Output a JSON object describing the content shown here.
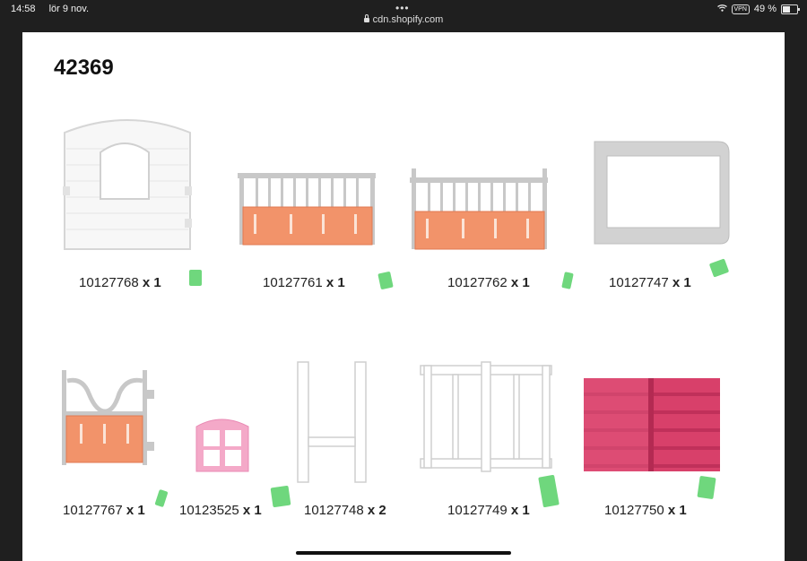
{
  "status": {
    "time": "14:58",
    "date": "lör 9 nov.",
    "vpn": "VPN",
    "battery": "49 %",
    "battery_level": 0.49
  },
  "browser": {
    "url": "cdn.shopify.com",
    "dots": "•••"
  },
  "doc": {
    "title": "42369",
    "parts": [
      {
        "number": "10127768",
        "qty": "x 1",
        "icon": "stable-wall-with-window"
      },
      {
        "number": "10127761",
        "qty": "x 1",
        "icon": "stall-gate-panel"
      },
      {
        "number": "10127762",
        "qty": "x 1",
        "icon": "stall-gate-panel"
      },
      {
        "number": "10127747",
        "qty": "x 1",
        "icon": "grey-frame"
      },
      {
        "number": "10127767",
        "qty": "x 1",
        "icon": "stall-door-with-arch"
      },
      {
        "number": "10123525",
        "qty": "x 1",
        "icon": "pink-window"
      },
      {
        "number": "10127748",
        "qty": "x 2",
        "icon": "h-post"
      },
      {
        "number": "10127749",
        "qty": "x 1",
        "icon": "white-fence-frame"
      },
      {
        "number": "10127750",
        "qty": "x 1",
        "icon": "pink-roof-panel"
      }
    ]
  },
  "colors": {
    "check": "#5fd36f",
    "gate": "#f2936a",
    "roof": "#d8406a",
    "window": "#f4a9c8"
  }
}
